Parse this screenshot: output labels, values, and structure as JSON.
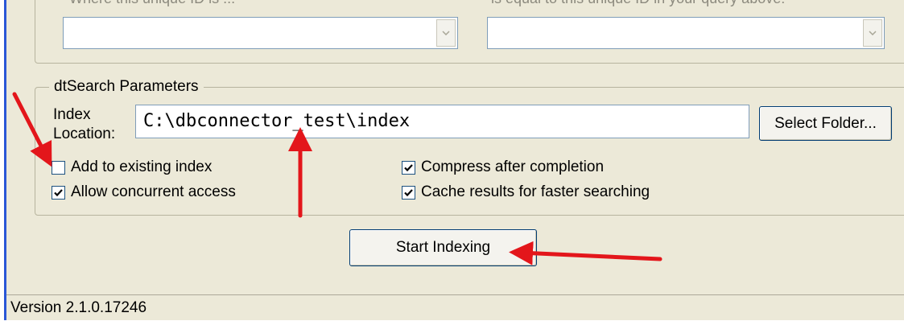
{
  "top_group": {
    "left_label": "Where this unique ID is ...",
    "right_label": "is equal to this unique ID in your query above:",
    "left_combo_value": "",
    "right_combo_value": ""
  },
  "dt_group": {
    "legend": "dtSearch Parameters",
    "index_label_line1": "Index",
    "index_label_line2": "Location:",
    "index_location": "C:\\dbconnector_test\\index",
    "select_folder": "Select Folder...",
    "add_existing": {
      "label": "Add to existing index",
      "checked": false
    },
    "allow_concurrent": {
      "label": "Allow concurrent access",
      "checked": true
    },
    "compress": {
      "label": "Compress after completion",
      "checked": true
    },
    "cache": {
      "label": "Cache results for faster searching",
      "checked": true
    }
  },
  "start_button": "Start Indexing",
  "status": {
    "version": "Version 2.1.0.17246"
  },
  "colors": {
    "annotation_arrow": "#e3161b",
    "window_bg": "#ece9d8",
    "window_border_left": "#2a57d6"
  }
}
